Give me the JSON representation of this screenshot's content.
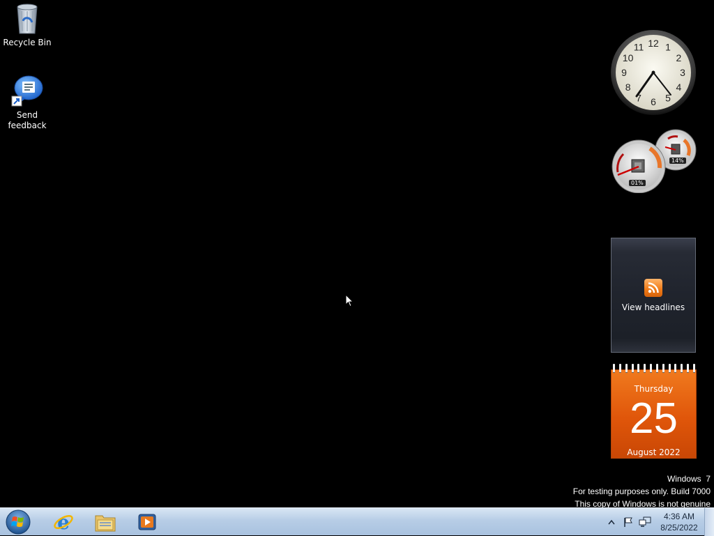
{
  "desktop": {
    "icons": [
      {
        "label": "Recycle Bin",
        "icon": "recycle-bin-icon"
      },
      {
        "label": "Send\nfeedback",
        "icon": "send-feedback-icon"
      }
    ]
  },
  "gadgets": {
    "clock": {
      "numbers": [
        "12",
        "1",
        "2",
        "3",
        "4",
        "5",
        "6",
        "7",
        "8",
        "9",
        "10",
        "11"
      ]
    },
    "cpu_meter": {
      "cpu_percent": "01%",
      "memory_percent": "14%"
    },
    "feed": {
      "label": "View headlines",
      "icon": "rss-icon"
    },
    "calendar": {
      "day_name": "Thursday",
      "day": "25",
      "month_year": "August 2022"
    }
  },
  "watermark": {
    "line1": "Windows  7",
    "line2": "For testing purposes only. Build 7000",
    "line3": "This copy of Windows is not genuine"
  },
  "taskbar": {
    "pinned": [
      "internet-explorer-icon",
      "windows-explorer-icon",
      "media-player-icon"
    ],
    "tray": {
      "time": "4:36 AM",
      "date": "8/25/2022",
      "icons": [
        "show-hidden-icons-icon",
        "action-center-flag-icon",
        "network-icon"
      ]
    }
  },
  "colors": {
    "desktop_background": "#000000",
    "calendar_orange": "#e0560a",
    "taskbar": "#b7cde6"
  }
}
